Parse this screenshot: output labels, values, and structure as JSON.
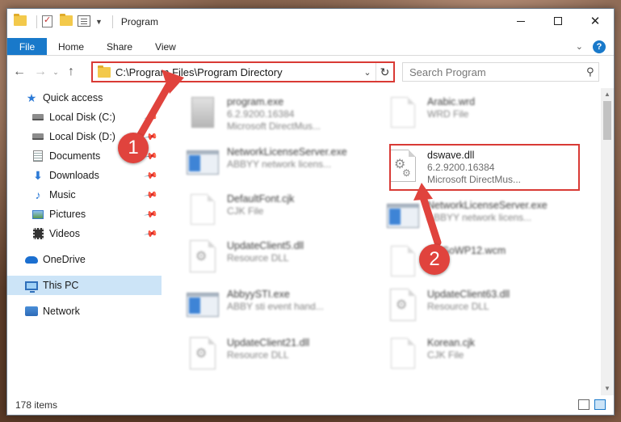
{
  "window": {
    "title": "Program"
  },
  "ribbon": {
    "tabs": [
      "File",
      "Home",
      "Share",
      "View"
    ]
  },
  "address": {
    "path": "C:\\Program Files\\Program Directory"
  },
  "search": {
    "placeholder": "Search Program"
  },
  "sidebar": {
    "items": [
      {
        "label": "Quick access",
        "icon": "star-icon"
      },
      {
        "label": "Local Disk (C:)",
        "icon": "disk-icon"
      },
      {
        "label": "Local Disk (D:)",
        "icon": "disk-icon"
      },
      {
        "label": "Documents",
        "icon": "documents-icon"
      },
      {
        "label": "Downloads",
        "icon": "download-icon"
      },
      {
        "label": "Music",
        "icon": "music-icon"
      },
      {
        "label": "Pictures",
        "icon": "pictures-icon"
      },
      {
        "label": "Videos",
        "icon": "videos-icon"
      },
      {
        "label": "OneDrive",
        "icon": "cloud-icon"
      },
      {
        "label": "This PC",
        "icon": "computer-icon"
      },
      {
        "label": "Network",
        "icon": "network-icon"
      }
    ]
  },
  "files": {
    "left": [
      {
        "name": "program.exe",
        "l1": "6.2.9200.16384",
        "l2": "Microsoft DirectMus..."
      },
      {
        "name": "NetworkLicenseServer.exe",
        "l1": "ABBYY network licens...",
        "l2": ""
      },
      {
        "name": "DefaultFont.cjk",
        "l1": "CJK File",
        "l2": ""
      },
      {
        "name": "UpdateClient5.dll",
        "l1": "Resource DLL",
        "l2": ""
      },
      {
        "name": "AbbyySTI.exe",
        "l1": "ABBY sti event hand...",
        "l2": ""
      },
      {
        "name": "UpdateClient21.dll",
        "l1": "Resource DLL",
        "l2": ""
      }
    ],
    "right": [
      {
        "name": "Arabic.wrd",
        "l1": "WRD File",
        "l2": ""
      },
      {
        "name": "dswave.dll",
        "l1": "6.2.9200.16384",
        "l2": "Microsoft DirectMus..."
      },
      {
        "name": "NetworkLicenseServer.exe",
        "l1": "ABBYY network licens...",
        "l2": ""
      },
      {
        "name": "SMSoWP12.wcm",
        "l1": "File",
        "l2": ""
      },
      {
        "name": "UpdateClient63.dll",
        "l1": "Resource DLL",
        "l2": ""
      },
      {
        "name": "Korean.cjk",
        "l1": "CJK File",
        "l2": ""
      }
    ]
  },
  "status": {
    "count": "178 items"
  },
  "annotations": {
    "one": "1",
    "two": "2",
    "color": "#e0433d"
  }
}
